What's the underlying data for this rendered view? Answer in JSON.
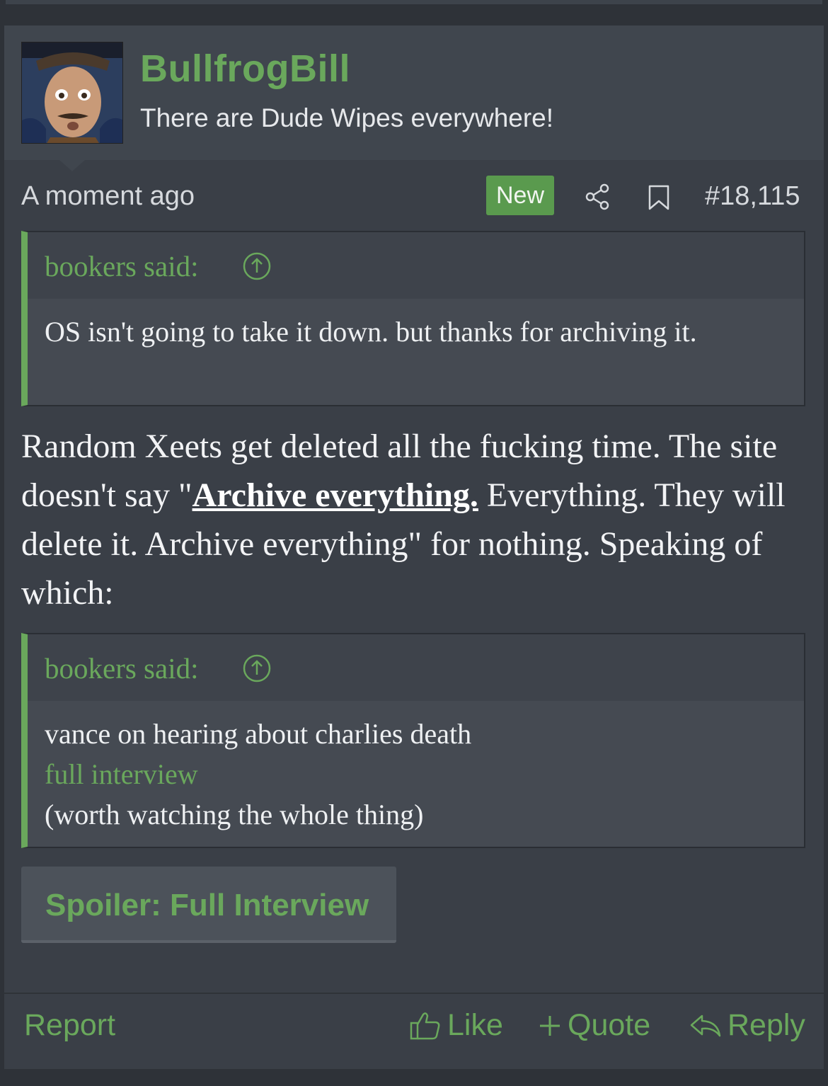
{
  "post": {
    "username": "BullfrogBill",
    "user_title": "There are Dude Wipes everywhere!",
    "timestamp": "A moment ago",
    "new_badge": "New",
    "post_number": "#18,115",
    "quotes": [
      {
        "author_label": "bookers said:",
        "lines": [
          "OS isn't going to take it down. but thanks for archiving it."
        ]
      },
      {
        "author_label": "bookers said:",
        "line1": "vance on hearing about charlies death",
        "link": "full interview",
        "line3": "(worth watching the whole thing)"
      }
    ],
    "body": {
      "part1": "Random Xeets get deleted all the fucking time. The site doesn't say \"",
      "link_text": "Archive everything.",
      "part2": " Everything. They will delete it. Archive everything\" for nothing. Speaking of which:"
    },
    "spoiler_label": "Spoiler: Full Interview",
    "actions": {
      "report": "Report",
      "like": "Like",
      "quote": "Quote",
      "reply": "Reply"
    }
  },
  "colors": {
    "accent": "#6aa85c",
    "background": "#3a3f47",
    "badge": "#5a9a4e"
  },
  "icons": [
    "share-icon",
    "bookmark-icon",
    "arrow-up-circle-icon",
    "thumbs-up-icon",
    "plus-icon",
    "reply-arrow-icon"
  ]
}
